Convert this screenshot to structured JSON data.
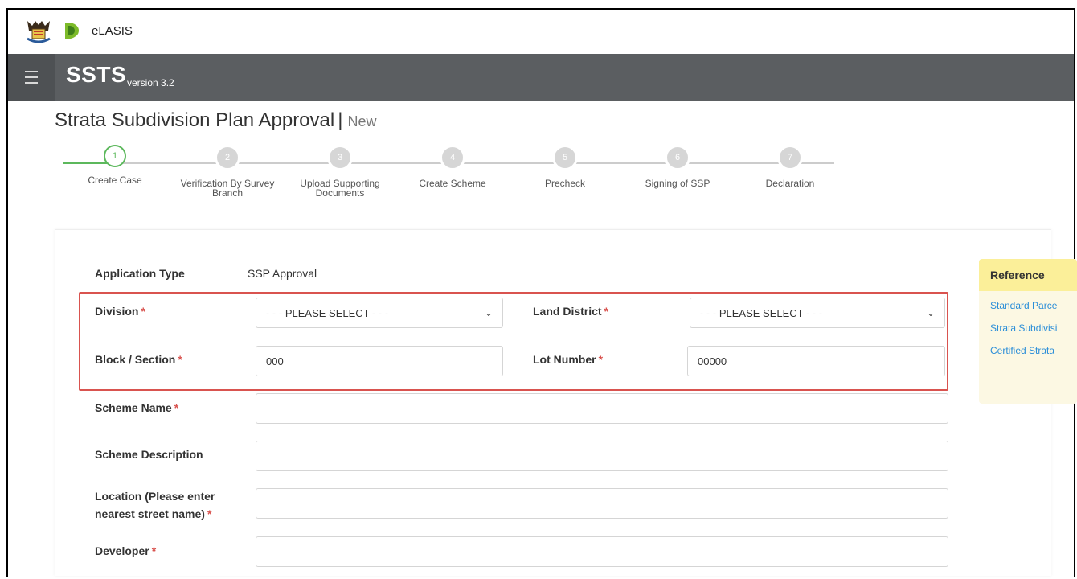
{
  "brand": {
    "app_name": "eLASIS"
  },
  "header": {
    "system_name": "SSTS",
    "version": "version 3.2"
  },
  "page": {
    "title": "Strata Subdivision Plan Approval",
    "separator": "|",
    "status": "New"
  },
  "stepper": {
    "steps": [
      {
        "number": "1",
        "label": "Create Case",
        "state": "active"
      },
      {
        "number": "2",
        "label": "Verification By Survey Branch",
        "state": "pending"
      },
      {
        "number": "3",
        "label": "Upload Supporting Documents",
        "state": "pending"
      },
      {
        "number": "4",
        "label": "Create Scheme",
        "state": "pending"
      },
      {
        "number": "5",
        "label": "Precheck",
        "state": "pending"
      },
      {
        "number": "6",
        "label": "Signing of SSP",
        "state": "pending"
      },
      {
        "number": "7",
        "label": "Declaration",
        "state": "pending"
      }
    ]
  },
  "form": {
    "application_type": {
      "label": "Application Type",
      "value": "SSP Approval"
    },
    "division": {
      "label": "Division",
      "required": "*",
      "selected": "- - - PLEASE SELECT - - -"
    },
    "land_district": {
      "label": "Land District",
      "required": "*",
      "selected": "- - - PLEASE SELECT - - -"
    },
    "block_section": {
      "label": "Block / Section",
      "required": "*",
      "value": "000"
    },
    "lot_number": {
      "label": "Lot Number",
      "required": "*",
      "value": "00000"
    },
    "scheme_name": {
      "label": "Scheme Name",
      "required": "*",
      "value": ""
    },
    "scheme_description": {
      "label": "Scheme Description",
      "value": ""
    },
    "location": {
      "label_line1": "Location (Please enter",
      "label_line2": "nearest street name)",
      "required": "*",
      "value": ""
    },
    "developer": {
      "label": "Developer",
      "required": "*",
      "value": ""
    }
  },
  "reference": {
    "title": "Reference",
    "links": [
      "Standard Parce",
      "Strata Subdivisi",
      "Certified Strata"
    ]
  },
  "colors": {
    "header_bg": "#5b5e61",
    "step_done": "#5cb85c",
    "required": "#d9534f",
    "link": "#2b8ed8",
    "reference_bg": "#fcf8e3"
  },
  "icons": {
    "menu": "hamburger-icon",
    "select": "chevron-down-icon"
  }
}
